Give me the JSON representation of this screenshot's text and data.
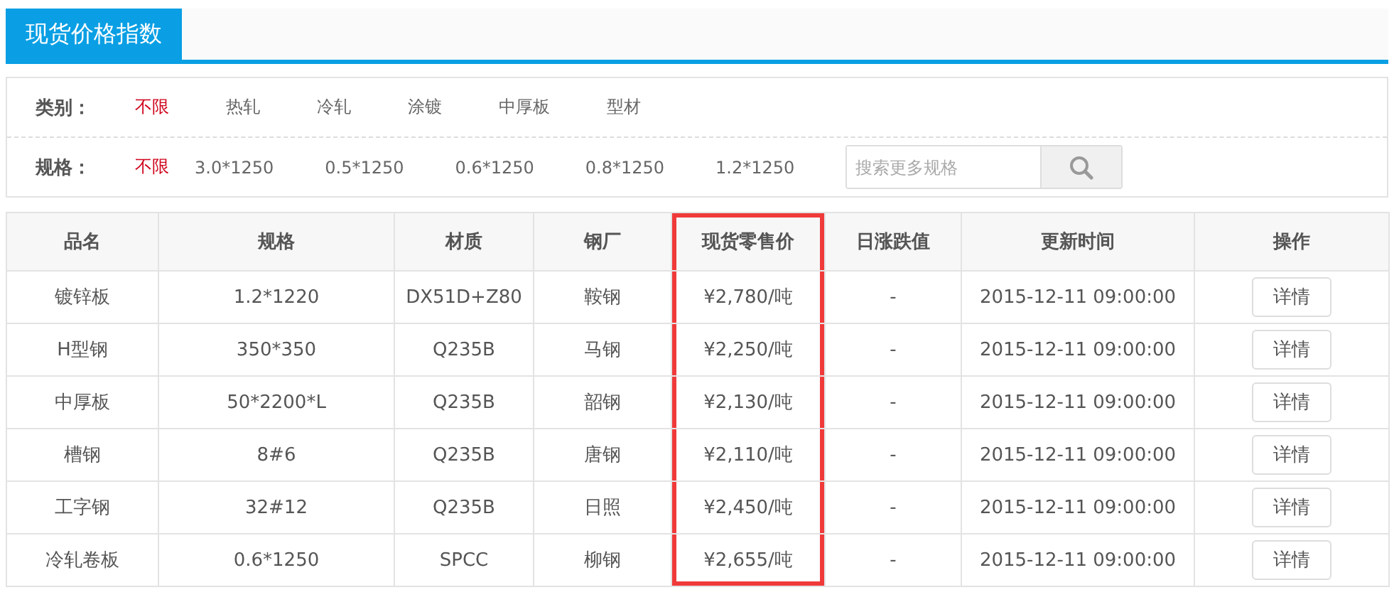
{
  "header": {
    "tabs": [
      {
        "label": "现货价格指数",
        "selected": true
      }
    ]
  },
  "filters": [
    {
      "label": "类别：",
      "options": [
        {
          "label": "不限",
          "selected": true
        },
        {
          "label": "热轧",
          "selected": false
        },
        {
          "label": "冷轧",
          "selected": false
        },
        {
          "label": "涂镀",
          "selected": false
        },
        {
          "label": "中厚板",
          "selected": false
        },
        {
          "label": "型材",
          "selected": false
        }
      ]
    },
    {
      "label": "规格：",
      "options": [
        {
          "label": "不限",
          "selected": true
        },
        {
          "label": "3.0*1250",
          "selected": false
        },
        {
          "label": "0.5*1250",
          "selected": false
        },
        {
          "label": "0.6*1250",
          "selected": false
        },
        {
          "label": "0.8*1250",
          "selected": false
        },
        {
          "label": "1.2*1250",
          "selected": false
        }
      ],
      "search": {
        "placeholder": "搜索更多规格"
      }
    }
  ],
  "table": {
    "columns": [
      {
        "label": "品名",
        "highlighted": false
      },
      {
        "label": "规格",
        "highlighted": false
      },
      {
        "label": "材质",
        "highlighted": false
      },
      {
        "label": "钢厂",
        "highlighted": false
      },
      {
        "label": "现货零售价",
        "highlighted": true
      },
      {
        "label": "日涨跌值",
        "highlighted": false
      },
      {
        "label": "更新时间",
        "highlighted": false
      },
      {
        "label": "操作",
        "highlighted": false
      }
    ],
    "rows": [
      [
        "镀锌板",
        "1.2*1220",
        "DX51D+Z80",
        "鞍钢",
        "¥2,780/吨",
        "-",
        "2015-12-11 09:00:00",
        "详情"
      ],
      [
        "H型钢",
        "350*350",
        "Q235B",
        "马钢",
        "¥2,250/吨",
        "-",
        "2015-12-11 09:00:00",
        "详情"
      ],
      [
        "中厚板",
        "50*2200*L",
        "Q235B",
        "韶钢",
        "¥2,130/吨",
        "-",
        "2015-12-11 09:00:00",
        "详情"
      ],
      [
        "槽钢",
        "8#6",
        "Q235B",
        "唐钢",
        "¥2,110/吨",
        "-",
        "2015-12-11 09:00:00",
        "详情"
      ],
      [
        "工字钢",
        "32#12",
        "Q235B",
        "日照",
        "¥2,450/吨",
        "-",
        "2015-12-11 09:00:00",
        "详情"
      ],
      [
        "冷轧卷板",
        "0.6*1250",
        "SPCC",
        "柳钢",
        "¥2,655/吨",
        "-",
        "2015-12-11 09:00:00",
        "详情"
      ]
    ]
  }
}
